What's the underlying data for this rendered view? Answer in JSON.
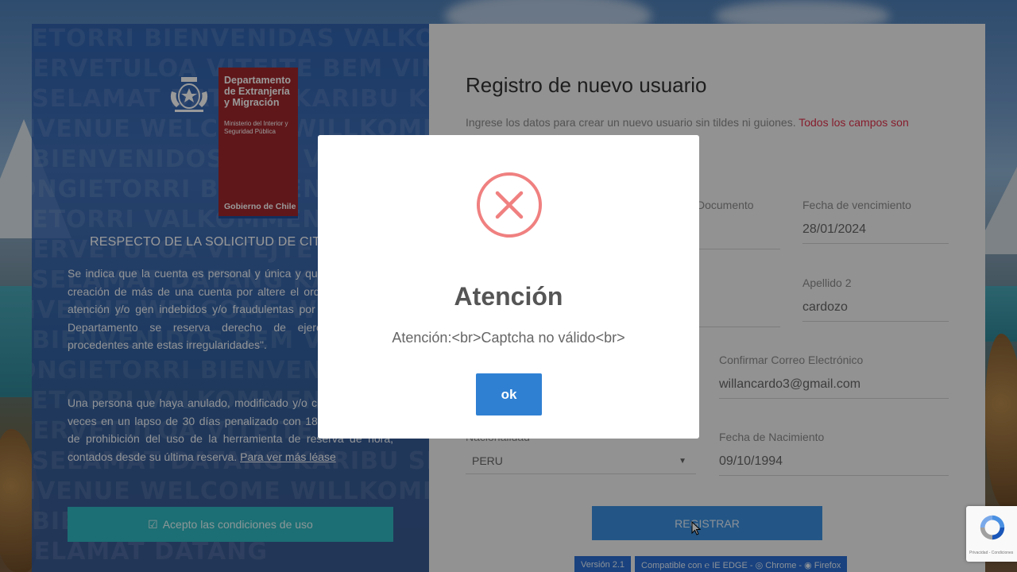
{
  "left_panel": {
    "welcome_words": [
      "ETORRI BIENVENIDAS VALKOMMEN BE",
      "TERVETULOA VITEJTE BEM VINDO",
      "SELAMAT DATANG KARIBU KWAKARIBISHA",
      "NVENUE WELCOME WILLKOMMEN",
      "BIENVENIDOS BEM VINDO",
      "ONGIETORRI BIENVENIDAS",
      "ETORRI VALKOMMEN BENVENUTO",
      "TERVETULOA VITEJTE BEM VINDO",
      "SELAMAT DATANG KARIBU",
      "NVENUE WELCOME WILLKOMMEN",
      "BIENVENIDOS BEM VINDO",
      "ONGIETORRI BIENVENIDAS",
      "ETORRI VALKOMMEN",
      "TERVETULOA VITEJTE BEM VINDO",
      "SELAMAT DATANG KARIBU SHA",
      "NVENUE WELCOME WILLKOMMEN",
      "BIENVENIDOS BEM VINDO",
      "SELAMAT DATANG"
    ],
    "logo": {
      "org_name": "Departamento de Extranjería y Migración",
      "ministry": "Ministerio del Interior y Seguridad Pública",
      "gov": "Gobierno de Chile"
    },
    "heading": "RESPECTO DE LA SOLICITUD DE CITA",
    "paragraph1": "Se indica que la cuenta es personal y única y que se detecte la creación de más de una cuenta por altere el orden previsto de atención y/o gen indebidos y/o fraudulentas por sobre otras at Departamento se reserva derecho de ejercer las sean procedentes ante estas irregularidades\".",
    "paragraph2": "Una persona que haya anulado, modificado y/o cita más de tres veces en un lapso de 30 días penalizado con 180 días corridos de prohibición del uso de la herramienta de reserva de hora, contados desde su última reserva.",
    "read_more": "Para ver más léase",
    "accept_label": "Acepto las condiciones de uso",
    "accept_icon": "checkbox-icon"
  },
  "form": {
    "title": "Registro de nuevo usuario",
    "subtitle": "Ingrese los datos para crear un nuevo usuario sin tildes ni guiones.",
    "subtitle_required": "Todos los campos son",
    "fields": {
      "documento_label": "Documento",
      "documento_value": "",
      "fecha_venc_label": "Fecha de vencimiento",
      "fecha_venc_value": "28/01/2024",
      "apellido1_label": "",
      "apellido1_value": "",
      "apellido2_label": "Apellido 2",
      "apellido2_value": "cardozo",
      "correo_label": "",
      "correo_value": "",
      "confirm_correo_label": "Confirmar Correo Electrónico",
      "confirm_correo_value": "willancardo3@gmail.com",
      "nacionalidad_label": "Nacionalidad",
      "nacionalidad_value": "PERU",
      "fecha_nac_label": "Fecha de Nacimiento",
      "fecha_nac_value": "09/10/1994"
    },
    "register_label": "REGISTRAR",
    "version_badge": "Versión 2.1",
    "compat_badge": "Compatible con ℮ IE EDGE - ◎ Chrome - ◉ Firefox"
  },
  "modal": {
    "title": "Atención",
    "message": "Atención:<br>Captcha no válido<br>",
    "ok_label": "ok",
    "icon": "error-x-icon",
    "icon_color": "#f08080"
  },
  "recaptcha": {
    "text": "Privacidad - Condiciones"
  },
  "colors": {
    "left_panel": "#285aaa",
    "accent_blue": "#2f80d3",
    "accept_teal": "#2fb9c2",
    "required_red": "#e0314b",
    "logo_red": "#a0272c"
  }
}
